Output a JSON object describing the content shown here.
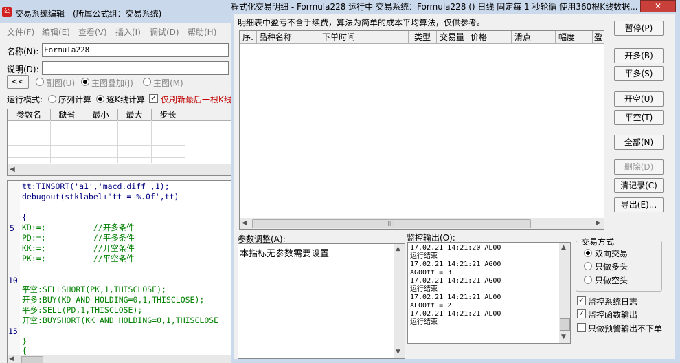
{
  "editor": {
    "title": "交易系统编辑 - (所属公式组：交易系统)",
    "menu": [
      "文件(F)",
      "编辑(E)",
      "查看(V)",
      "插入(I)",
      "调试(D)",
      "帮助(H)"
    ],
    "name_label": "名称(N):",
    "name_value": "Formula228",
    "desc_label": "说明(D):",
    "collapse_btn": "<<",
    "view_options": [
      "副图(U)",
      "主图叠加(J)",
      "主图(M)"
    ],
    "run_mode_label": "运行模式:",
    "run_modes": [
      "序列计算",
      "逐K线计算"
    ],
    "refresh_last_label": "仅刷新最后一根K线",
    "param_headers": [
      "参数名",
      "缺省",
      "最小",
      "最大",
      "步长"
    ],
    "line_numbers": [
      "5",
      "10",
      "15"
    ],
    "code": [
      "tt:TINSORT('a1','macd.diff',1);",
      "debugout(stklabel+'tt = %.0f',tt)",
      "",
      "{",
      "KD:=;          //开多条件",
      "PD:=;          //平多条件",
      "KK:=;          //开空条件",
      "PK:=;          //平空条件",
      "",
      "",
      "平空:SELLSHORT(PK,1,THISCLOSE);",
      "开多:BUY(KD AND HOLDING=0,1,THISCLOSE);",
      "平多:SELL(PD,1,THISCLOSE);",
      "开空:BUYSHORT(KK AND HOLDING=0,1,THISCLOSE",
      "",
      "}",
      "{"
    ]
  },
  "trade": {
    "title": "程式化交易明细 - Formula228 运行中  交易系统：Formula228 () 日线 固定每 1 秒轮循 使用360根K线数据...",
    "close_glyph": "✕",
    "notice": "明细表中盈亏不含手续费，算法为简单的成本平均算法，仅供参考。",
    "columns": [
      "序.",
      "品种名称",
      "下单时间",
      "类型",
      "交易量",
      "价格",
      "滑点",
      "幅度",
      "盈"
    ],
    "buttons": {
      "pause": "暂停(P)",
      "open_long": "开多(B)",
      "close_long": "平多(S)",
      "open_short": "开空(U)",
      "close_short": "平空(T)",
      "close_all": "全部(N)",
      "delete": "删除(D)",
      "clear_log": "清记录(C)",
      "export": "导出(E)..."
    },
    "param_adjust_label": "参数调整(A):",
    "param_adjust_text": "本指标无参数需要设置",
    "monitor_label": "监控输出(O):",
    "monitor_lines": [
      "17.02.21 14:21:20 AL00",
      "运行结束",
      "17.02.21 14:21:21 AG00",
      "AG00tt = 3",
      "17.02.21 14:21:21 AG00",
      "运行结束",
      "17.02.21 14:21:21 AL00",
      "AL00tt = 2",
      "17.02.21 14:21:21 AL00",
      "运行结束"
    ],
    "trade_mode_label": "交易方式",
    "trade_modes": [
      "双向交易",
      "只做多头",
      "只做空头"
    ],
    "checks": [
      "监控系统日志",
      "监控函数输出",
      "只做预警输出不下单"
    ]
  }
}
